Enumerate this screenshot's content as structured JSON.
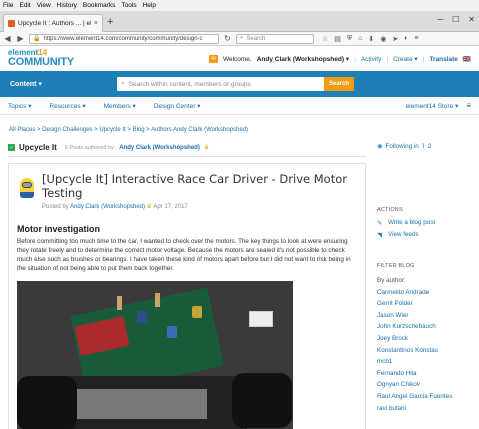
{
  "browser": {
    "menu": [
      "File",
      "Edit",
      "View",
      "History",
      "Bookmarks",
      "Tools",
      "Help"
    ],
    "tab_title": "Upcycle It : Authors ... | ele...",
    "tab_close": "×",
    "new_tab": "+",
    "url": "https://www.element14.com/community/community/design-c",
    "search_placeholder": "Search",
    "win_min": "─",
    "win_max": "☐",
    "win_close": "✕"
  },
  "site": {
    "logo_top": "element",
    "logo_accent": "14",
    "logo_bottom": "COMMUNITY",
    "welcome": "Welcome,",
    "user_name": "Andy Clark (Workshopshed) ▾",
    "activity": "Activity",
    "create": "Create ▾",
    "translate": "Translate",
    "mail_count": "✉",
    "content_label": "Content ▾",
    "search_placeholder": "Search within content, members or groups",
    "search_button": "Search"
  },
  "sitenav": {
    "items": [
      "Topics ▾",
      "Resources ▾",
      "Members ▾",
      "Design Center ▾"
    ],
    "store": "element14 Store ▾"
  },
  "breadcrumb": "All Places > Design Challenges > Upcycle It > Blog > Authors Andy Clark (Workshopshed)",
  "blog": {
    "title": "Upcycle It",
    "count": "6 Posts authored by:",
    "author": "Andy Clark (Workshopshed)"
  },
  "post": {
    "title": "[Upcycle It] Interactive Race Car Driver - Drive Motor Testing",
    "posted_by": "Posted by",
    "author": "Andy Clark (Workshopshed)",
    "date": "Apr 17, 2017",
    "section_title": "Motor investigation",
    "body": "Before committing too much time to the car, I wanted to check over the motors. The key things to look at were ensuring they rotate freely and to determine the correct motor voltage. Because the motors are sealed it's not possible to check much else such as brushes or bearings. I have taken these kind of motors apart before but I did not want to risk being in the situation of not being able to put them back together."
  },
  "sidebar": {
    "following": "Following in",
    "following_count": "2",
    "actions_heading": "ACTIONS",
    "write_post": "Write a blog post",
    "view_feeds": "View feeds",
    "filter_heading": "FILTER BLOG",
    "by_author": "By author:",
    "authors": [
      "Carmelito Andrade",
      "Gerrit Polder",
      "Jason Wier",
      "John Kurzschebauch",
      "Joey Brock",
      "Konstantinos Konstas",
      "mcb1",
      "Fernando Hila",
      "Ognyan Chikov",
      "Raul Angel Garcia Fuentes",
      "ravi butani"
    ]
  }
}
